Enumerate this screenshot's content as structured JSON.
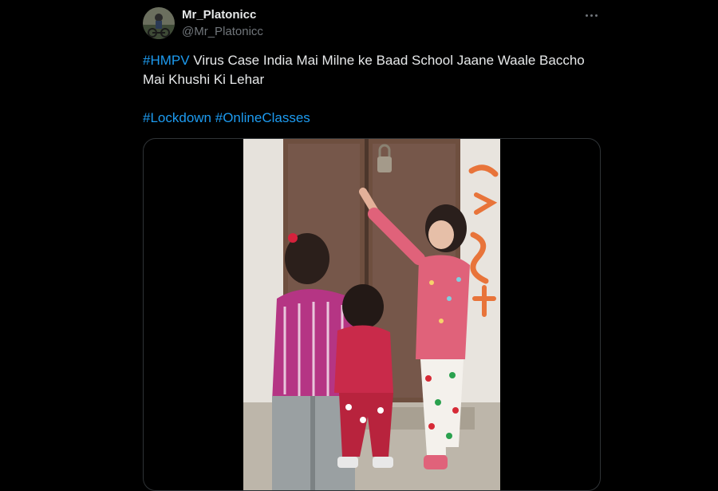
{
  "author": {
    "display_name": "Mr_Platonicc",
    "handle": "@Mr_Platonicc"
  },
  "tweet": {
    "hashtag_1": "#HMPV",
    "text_1": " Virus Case India Mai Milne ke Baad School Jaane Waale Baccho Mai Khushi Ki Lehar",
    "hashtag_2": "#Lockdown",
    "hashtag_3": "#OnlineClasses"
  },
  "colors": {
    "background": "#000000",
    "text": "#e7e9ea",
    "secondary": "#71767b",
    "link": "#1d9bf0",
    "border": "#2f3336"
  },
  "icons": {
    "more": "more-horizontal-icon"
  }
}
